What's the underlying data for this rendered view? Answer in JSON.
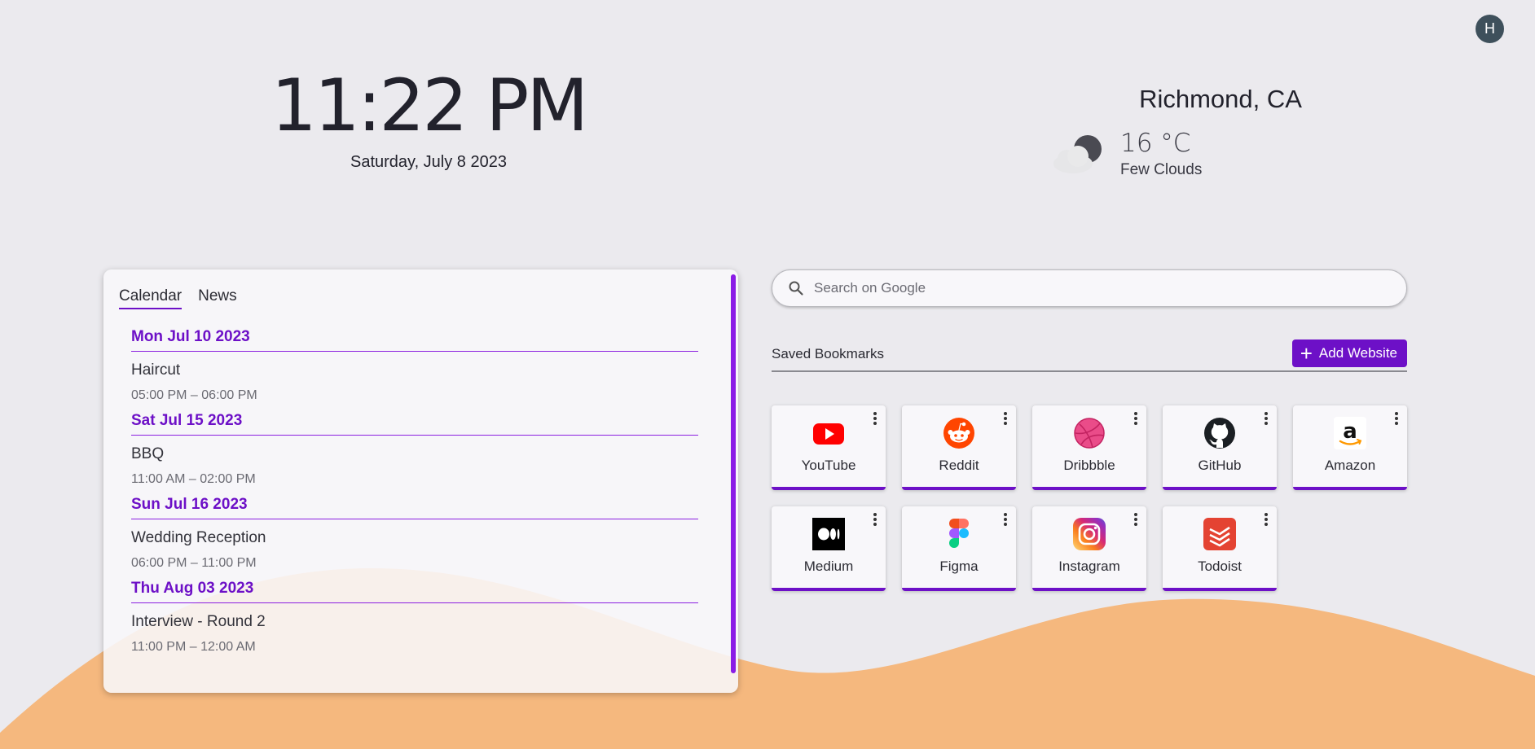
{
  "user": {
    "avatar_initial": "H"
  },
  "clock": {
    "time": "11:22 PM",
    "date": "Saturday, July 8 2023"
  },
  "weather": {
    "city": "Richmond, CA",
    "temperature": "16 °C",
    "description": "Few Clouds",
    "icon": "moon-cloud-icon"
  },
  "panel": {
    "tabs": [
      {
        "label": "Calendar",
        "active": true
      },
      {
        "label": "News",
        "active": false
      }
    ],
    "events": [
      {
        "date": "Mon Jul 10 2023",
        "title": "Haircut",
        "time": "05:00 PM – 06:00 PM"
      },
      {
        "date": "Sat Jul 15 2023",
        "title": "BBQ",
        "time": "11:00 AM – 02:00 PM"
      },
      {
        "date": "Sun Jul 16 2023",
        "title": "Wedding Reception",
        "time": "06:00 PM – 11:00 PM"
      },
      {
        "date": "Thu Aug 03 2023",
        "title": "Interview - Round 2",
        "time": "11:00 PM – 12:00 AM"
      }
    ]
  },
  "search": {
    "placeholder": "Search on Google"
  },
  "bookmarks": {
    "title": "Saved Bookmarks",
    "add_label": "Add Website",
    "items": [
      {
        "label": "YouTube",
        "icon": "youtube-icon"
      },
      {
        "label": "Reddit",
        "icon": "reddit-icon"
      },
      {
        "label": "Dribbble",
        "icon": "dribbble-icon"
      },
      {
        "label": "GitHub",
        "icon": "github-icon"
      },
      {
        "label": "Amazon",
        "icon": "amazon-icon"
      },
      {
        "label": "Medium",
        "icon": "medium-icon"
      },
      {
        "label": "Figma",
        "icon": "figma-icon"
      },
      {
        "label": "Instagram",
        "icon": "instagram-icon"
      },
      {
        "label": "Todoist",
        "icon": "todoist-icon"
      }
    ]
  },
  "colors": {
    "accent": "#6d10c7",
    "background": "#ebeaee",
    "wave": "#f5b87e"
  }
}
